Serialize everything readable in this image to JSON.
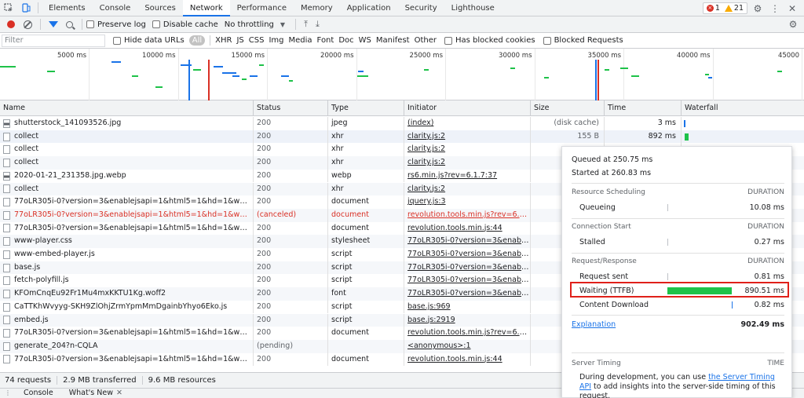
{
  "tabs": [
    "Elements",
    "Console",
    "Sources",
    "Network",
    "Performance",
    "Memory",
    "Application",
    "Security",
    "Lighthouse"
  ],
  "active_tab": "Network",
  "issues": {
    "errors": "1",
    "warnings": "21"
  },
  "toolbar": {
    "preserve_log": "Preserve log",
    "disable_cache": "Disable cache",
    "throttling": "No throttling"
  },
  "filterbar": {
    "placeholder": "Filter",
    "hide_data_urls": "Hide data URLs",
    "all": "All",
    "types": [
      "XHR",
      "JS",
      "CSS",
      "Img",
      "Media",
      "Font",
      "Doc",
      "WS",
      "Manifest",
      "Other"
    ],
    "blocked_cookies": "Has blocked cookies",
    "blocked_requests": "Blocked Requests"
  },
  "overview": {
    "ticks": [
      "5000 ms",
      "10000 ms",
      "15000 ms",
      "20000 ms",
      "25000 ms",
      "30000 ms",
      "35000 ms",
      "40000 ms",
      "45000"
    ]
  },
  "columns": [
    "Name",
    "Status",
    "Type",
    "Initiator",
    "Size",
    "Time",
    "Waterfall"
  ],
  "rows": [
    {
      "name": "shutterstock_141093526.jpg",
      "status": "200",
      "type": "jpeg",
      "initiator": "(index)",
      "size": "(disk cache)",
      "time": "3 ms",
      "icon": "img",
      "err": false
    },
    {
      "name": "collect",
      "status": "200",
      "type": "xhr",
      "initiator": "clarity.js:2",
      "size": "155 B",
      "time": "892 ms",
      "icon": "doc",
      "err": false
    },
    {
      "name": "collect",
      "status": "200",
      "type": "xhr",
      "initiator": "clarity.js:2",
      "size": "",
      "time": "",
      "icon": "doc",
      "err": false
    },
    {
      "name": "collect",
      "status": "200",
      "type": "xhr",
      "initiator": "clarity.js:2",
      "size": "",
      "time": "",
      "icon": "doc",
      "err": false
    },
    {
      "name": "2020-01-21_231358.jpg.webp",
      "status": "200",
      "type": "webp",
      "initiator": "rs6.min.js?rev=6.1.7:37",
      "size": "",
      "time": "",
      "icon": "img",
      "err": false
    },
    {
      "name": "collect",
      "status": "200",
      "type": "xhr",
      "initiator": "clarity.js:2",
      "size": "",
      "time": "",
      "icon": "doc",
      "err": false
    },
    {
      "name": "77oLR305i-0?version=3&enablejsapi=1&html5=1&hd=1&w…el=0&o…",
      "status": "200",
      "type": "document",
      "initiator": "jquery.js:3",
      "size": "",
      "time": "",
      "icon": "doc",
      "err": false
    },
    {
      "name": "77oLR305i-0?version=3&enablejsapi=1&html5=1&hd=1&w…el=0&o…",
      "status": "(canceled)",
      "type": "document",
      "initiator": "revolution.tools.min.js?rev=6.1.7:44",
      "size": "",
      "time": "",
      "icon": "doc",
      "err": true
    },
    {
      "name": "77oLR305i-0?version=3&enablejsapi=1&html5=1&hd=1&w…el=0&o…",
      "status": "200",
      "type": "document",
      "initiator": "revolution.tools.min.js:44",
      "size": "",
      "time": "",
      "icon": "doc",
      "err": false
    },
    {
      "name": "www-player.css",
      "status": "200",
      "type": "stylesheet",
      "initiator": "77oLR305i-0?version=3&enablej…",
      "size": "",
      "time": "",
      "icon": "doc",
      "err": false
    },
    {
      "name": "www-embed-player.js",
      "status": "200",
      "type": "script",
      "initiator": "77oLR305i-0?version=3&enablej…",
      "size": "",
      "time": "",
      "icon": "doc",
      "err": false
    },
    {
      "name": "base.js",
      "status": "200",
      "type": "script",
      "initiator": "77oLR305i-0?version=3&enablej…",
      "size": "",
      "time": "",
      "icon": "doc",
      "err": false
    },
    {
      "name": "fetch-polyfill.js",
      "status": "200",
      "type": "script",
      "initiator": "77oLR305i-0?version=3&enablej…",
      "size": "",
      "time": "",
      "icon": "doc",
      "err": false
    },
    {
      "name": "KFOmCnqEu92Fr1Mu4mxKKTU1Kg.woff2",
      "status": "200",
      "type": "font",
      "initiator": "77oLR305i-0?version=3&enablej…",
      "size": "",
      "time": "",
      "icon": "doc",
      "err": false
    },
    {
      "name": "CaTTKhWvyyg-SKH9ZlOhjZrmYpmMmDgainbYhyo6Eko.js",
      "status": "200",
      "type": "script",
      "initiator": "base.js:969",
      "size": "",
      "time": "",
      "icon": "doc",
      "err": false
    },
    {
      "name": "embed.js",
      "status": "200",
      "type": "script",
      "initiator": "base.js:2919",
      "size": "",
      "time": "",
      "icon": "doc",
      "err": false
    },
    {
      "name": "77oLR305i-0?version=3&enablejsapi=1&html5=1&hd=1&w…el=0&o…",
      "status": "200",
      "type": "document",
      "initiator": "revolution.tools.min.js?rev=6.1.7:44",
      "size": "",
      "time": "",
      "icon": "doc",
      "err": false
    },
    {
      "name": "generate_204?n-CQLA",
      "status": "(pending)",
      "type": "",
      "initiator": "<anonymous>:1",
      "size": "",
      "time": "",
      "icon": "doc",
      "err": false
    },
    {
      "name": "77oLR305i-0?version=3&enablejsapi=1&html5=1&hd=1&w…el=0&o…",
      "status": "200",
      "type": "document",
      "initiator": "revolution.tools.min.js:44",
      "size": "",
      "time": "",
      "icon": "doc",
      "err": false
    }
  ],
  "status_bar": [
    "74 requests",
    "2.9 MB transferred",
    "9.6 MB resources"
  ],
  "drawer_tabs": [
    "Console",
    "What's New"
  ],
  "timing": {
    "queued": "Queued at 250.75 ms",
    "started": "Started at 260.83 ms",
    "duration_label": "DURATION",
    "sections": [
      {
        "title": "Resource Scheduling",
        "rows": [
          {
            "label": "Queueing",
            "value": "10.08 ms"
          }
        ]
      },
      {
        "title": "Connection Start",
        "rows": [
          {
            "label": "Stalled",
            "value": "0.27 ms"
          }
        ]
      },
      {
        "title": "Request/Response",
        "rows": [
          {
            "label": "Request sent",
            "value": "0.81 ms"
          },
          {
            "label": "Waiting (TTFB)",
            "value": "890.51 ms"
          },
          {
            "label": "Content Download",
            "value": "0.82 ms"
          }
        ]
      }
    ],
    "explanation": "Explanation",
    "total": "902.49 ms",
    "server_timing": "Server Timing",
    "time_label": "TIME",
    "desc_before": "During development, you can use ",
    "desc_link": "the Server Timing API",
    "desc_after": " to add insights into the server-side timing of this request.",
    "bar_color": "#1ec249"
  }
}
